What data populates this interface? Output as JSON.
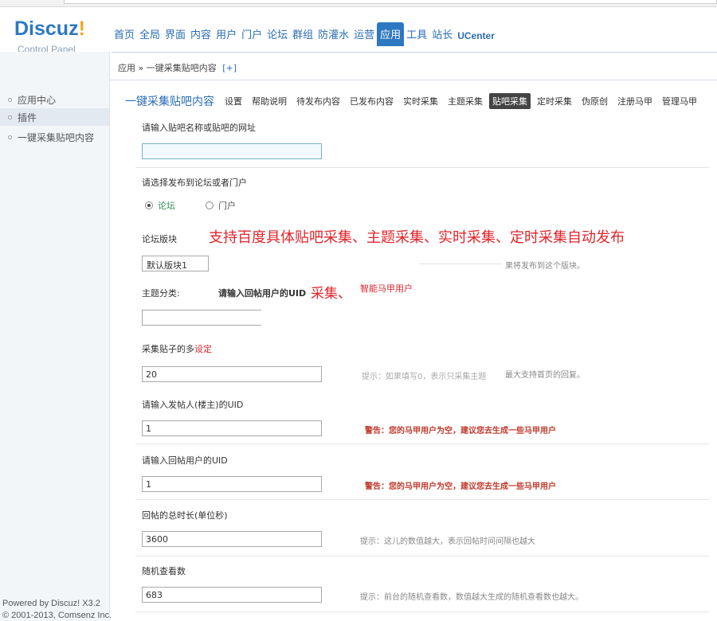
{
  "brand": {
    "logo": "Discuz",
    "logo_mark": "!",
    "subtitle": "Control Panel"
  },
  "top_nav": [
    {
      "label": "首页"
    },
    {
      "label": "全局"
    },
    {
      "label": "界面"
    },
    {
      "label": "内容"
    },
    {
      "label": "用户"
    },
    {
      "label": "门户"
    },
    {
      "label": "论坛"
    },
    {
      "label": "群组"
    },
    {
      "label": "防灌水"
    },
    {
      "label": "运营"
    },
    {
      "label": "应用",
      "active": true
    },
    {
      "label": "工具"
    },
    {
      "label": "站长"
    },
    {
      "label": "UCenter"
    }
  ],
  "breadcrumb": {
    "root": "应用",
    "sep": "»",
    "current": "一键采集贴吧内容",
    "add": "[+]"
  },
  "sidebar": {
    "items": [
      {
        "label": "应用中心"
      },
      {
        "label": "插件",
        "current": true
      },
      {
        "label": "一键采集贴吧内容"
      }
    ],
    "footer_line1": "Powered by Discuz! X3.2",
    "footer_line2": "© 2001-2013, Comsenz Inc."
  },
  "plugin_title": "一键采集贴吧内容",
  "tabs": [
    {
      "label": "设置"
    },
    {
      "label": "帮助说明"
    },
    {
      "label": "待发布内容"
    },
    {
      "label": "已发布内容"
    },
    {
      "label": "实时采集"
    },
    {
      "label": "主题采集"
    },
    {
      "label": "贴吧采集",
      "active": true
    },
    {
      "label": "定时采集"
    },
    {
      "label": "伪原创"
    },
    {
      "label": "注册马甲"
    },
    {
      "label": "管理马甲"
    }
  ],
  "form": {
    "tieba": {
      "label": "请输入贴吧名称或贴吧的网址",
      "value": ""
    },
    "target": {
      "label": "请选择发布到论坛或者门户",
      "opt_forum": "论坛",
      "opt_portal": "门户"
    },
    "forum_block": {
      "label": "论坛版块",
      "value": "默认版块1",
      "hint": "果将发布到这个版块。"
    },
    "category": {
      "label": "主题分类:",
      "value": ""
    },
    "amount": {
      "label": "采集贴子的多",
      "label_suffix": "设定",
      "value": "20",
      "hint": "最大支持首页的回复。",
      "hint_faint": "提示：如果填写0，表示只采集主题"
    },
    "poster_uid": {
      "label": "请输入发帖人(楼主)的UID",
      "value": "1",
      "warning": "警告：您的马甲用户为空，建议您去生成一些马甲用户"
    },
    "reply_uid": {
      "label": "请输入回帖用户的UID",
      "value": "1",
      "warning": "警告：您的马甲用户为空，建议您去生成一些马甲用户"
    },
    "duration": {
      "label": "回帖的总时长(单位秒)",
      "value": "3600",
      "hint": "提示：这儿的数值越大，表示回帖时间间隔也越大"
    },
    "views": {
      "label": "随机查看数",
      "value": "683",
      "hint": "提示：前台的随机查看数，数值越大生成的随机查看数也越大。"
    }
  },
  "overlay": {
    "headline": "支持百度具体贴吧采集、主题采集、实时采集、定时采集自动发布",
    "reply_label": "请输入回帖用户的UID",
    "caiji": "采集、",
    "smart_majia": "智能马甲用户"
  }
}
